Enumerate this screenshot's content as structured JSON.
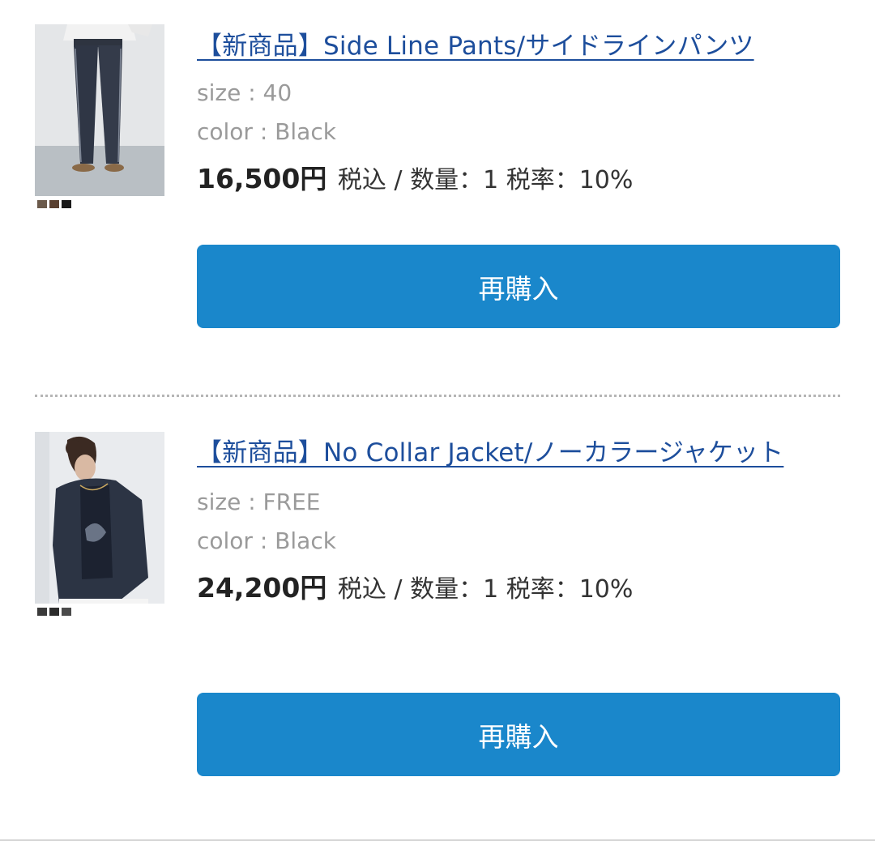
{
  "items": [
    {
      "title": "【新商品】Side Line Pants/サイドラインパンツ",
      "size": "size : 40",
      "color": "color : Black",
      "price": "16,500円",
      "price_meta": "税込 / 数量：1 税率：10%",
      "rebuy_label": "再購入",
      "swatch_colors": [
        "#6b5a4b",
        "#5a4030",
        "#1a1a1a"
      ]
    },
    {
      "title": "【新商品】No Collar Jacket/ノーカラージャケット",
      "size": "size : FREE",
      "color": "color : Black",
      "price": "24,200円",
      "price_meta": "税込 / 数量：1 税率：10%",
      "rebuy_label": "再購入",
      "swatch_colors": [
        "#3a3a3a",
        "#2c2c2c",
        "#4a4a4a"
      ]
    }
  ],
  "colors": {
    "link": "#1d4e9c",
    "button": "#1a87cb",
    "muted_text": "#9a9a9a"
  }
}
